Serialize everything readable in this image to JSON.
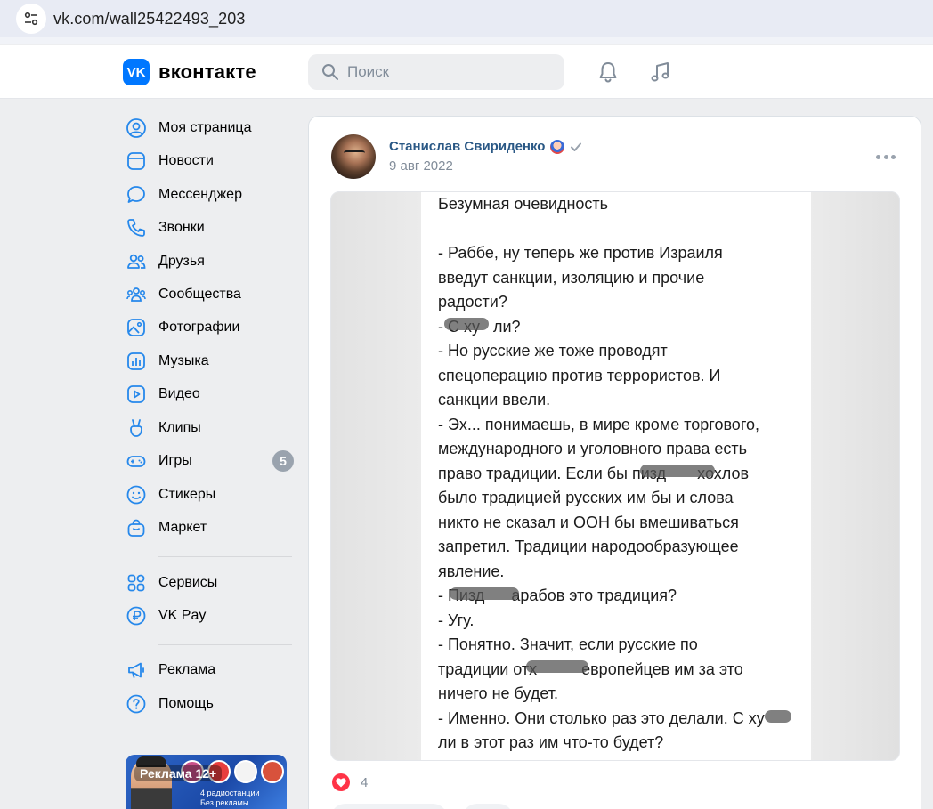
{
  "browser": {
    "url": "vk.com/wall25422493_203",
    "site_icon": "tune-icon"
  },
  "header": {
    "logo_text": "вконтакте",
    "logo_badge": "VK",
    "search_placeholder": "Поиск",
    "icons": [
      "bell-icon",
      "music-note-icon"
    ],
    "accent": "#0077ff"
  },
  "sidebar": {
    "items": [
      {
        "label": "Моя страница",
        "icon": "user-circle-icon"
      },
      {
        "label": "Новости",
        "icon": "news-icon"
      },
      {
        "label": "Мессенджер",
        "icon": "message-icon"
      },
      {
        "label": "Звонки",
        "icon": "phone-icon"
      },
      {
        "label": "Друзья",
        "icon": "friends-icon"
      },
      {
        "label": "Сообщества",
        "icon": "communities-icon"
      },
      {
        "label": "Фотографии",
        "icon": "photo-icon"
      },
      {
        "label": "Музыка",
        "icon": "music-icon"
      },
      {
        "label": "Видео",
        "icon": "video-icon"
      },
      {
        "label": "Клипы",
        "icon": "clips-icon"
      },
      {
        "label": "Игры",
        "icon": "gamepad-icon",
        "badge": "5"
      },
      {
        "label": "Стикеры",
        "icon": "smile-icon"
      },
      {
        "label": "Маркет",
        "icon": "bag-icon"
      }
    ],
    "items2": [
      {
        "label": "Сервисы",
        "icon": "grid-icon"
      },
      {
        "label": "VK Pay",
        "icon": "ruble-icon"
      }
    ],
    "items3": [
      {
        "label": "Реклама",
        "icon": "megaphone-icon"
      },
      {
        "label": "Помощь",
        "icon": "help-icon"
      }
    ],
    "promo": {
      "label": "Реклама 12+",
      "caption_line1": "4 радиостанции",
      "caption_line2": "Без рекламы"
    }
  },
  "post": {
    "author": "Станислав Свириденко",
    "date": "9 авг 2022",
    "likes": "4",
    "photo_text": "Безумная очевидность\n\n- Раббе, ну теперь же против Израиля\nвведут санкции, изоляцию и прочие\nрадости?\n- С ху   ли?\n- Но русские же тоже проводят\nспецоперацию против террористов. И\nсанкции ввели.\n- Эх... понимаешь, в мире кроме торгового,\nмеждународного и уголовного права есть\nправо традиции. Если бы пизд       хохлов\nбыло традицией русских им бы и слова\nникто не сказал и ООН бы вмешиваться\nзапретил. Традиции народообразующее\nявление.\n- Пизд      арабов это традиция?\n- Угу.\n- Понятно. Значит, если русские по\nтрадиции отх          европейцев им за это\nничего не будет.\n- Именно. Они столько раз это делали. С ху\nли в этот раз им что-то будет?"
  }
}
